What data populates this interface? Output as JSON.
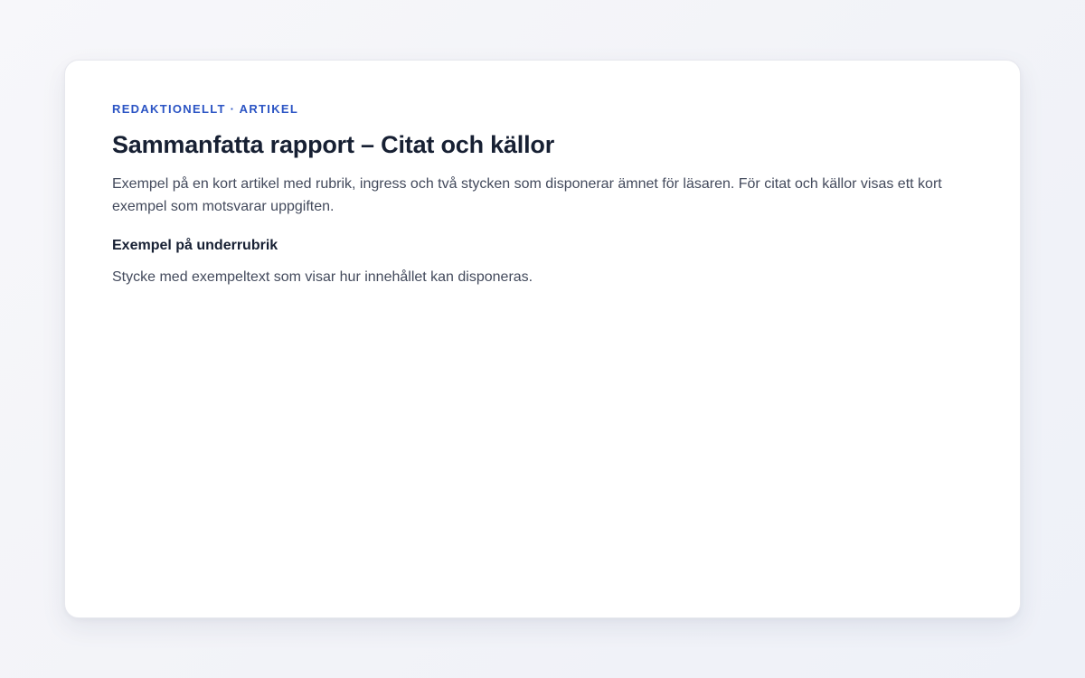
{
  "article": {
    "eyebrow": "REDAKTIONELLT · ARTIKEL",
    "title": "Sammanfatta rapport – Citat och källor",
    "lead": "Exempel på en kort artikel med rubrik, ingress och två stycken som disponerar ämnet för läsaren. För citat och källor visas ett kort exempel som motsvarar uppgiften.",
    "subheading": "Exempel på underrubrik",
    "paragraph": "Stycke med exempeltext som visar hur innehållet kan disponeras."
  },
  "colors": {
    "accent": "#2b54c4",
    "heading": "#172033",
    "body_text": "#434a5c",
    "card_background": "#ffffff",
    "page_background": "#f4f5f9"
  }
}
